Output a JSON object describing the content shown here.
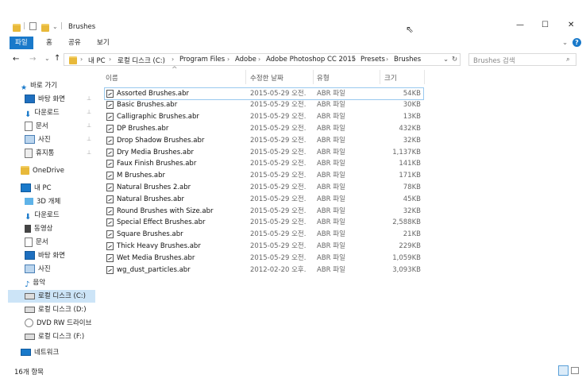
{
  "window": {
    "title": "Brushes",
    "controls": {
      "minimize": "—",
      "maximize": "☐",
      "close": "✕"
    }
  },
  "ribbon": {
    "tabs": [
      {
        "label": "파일",
        "active": true
      },
      {
        "label": "홈",
        "active": false
      },
      {
        "label": "공유",
        "active": false
      },
      {
        "label": "보기",
        "active": false
      }
    ],
    "expand": "⌄",
    "help": "?"
  },
  "address": {
    "back": "←",
    "forward": "→",
    "recent": "⌄",
    "up": "↑",
    "crumbs": [
      "내 PC",
      "로컬 디스크 (C:)",
      "Program Files",
      "Adobe",
      "Adobe Photoshop CC 2015",
      "Presets",
      "Brushes"
    ],
    "separator": "›",
    "dropdown": "⌄",
    "refresh": "↻",
    "search_placeholder": "Brushes 검색",
    "search_icon": "⌕"
  },
  "nav": {
    "quick_access": "바로 가기",
    "quick_items": [
      "바탕 화면",
      "다운로드",
      "문서",
      "사진",
      "휴지통"
    ],
    "onedrive": "OneDrive",
    "this_pc": "내 PC",
    "pc_items": [
      "3D 개체",
      "다운로드",
      "동영상",
      "문서",
      "바탕 화면",
      "사진",
      "음악",
      "로컬 디스크 (C:)",
      "로컬 디스크 (D:)",
      "DVD RW 드라이브",
      "로컬 디스크 (F:)"
    ],
    "network": "네트워크",
    "pin": "📌"
  },
  "columns": {
    "name": "이름",
    "date": "수정한 날짜",
    "type": "유형",
    "size": "크기",
    "sort_arrow": "^"
  },
  "files": [
    {
      "name": "Assorted Brushes.abr",
      "date": "2015-05-29 오전...",
      "type": "ABR 파일",
      "size": "54KB"
    },
    {
      "name": "Basic Brushes.abr",
      "date": "2015-05-29 오전...",
      "type": "ABR 파일",
      "size": "30KB"
    },
    {
      "name": "Calligraphic Brushes.abr",
      "date": "2015-05-29 오전...",
      "type": "ABR 파일",
      "size": "13KB"
    },
    {
      "name": "DP Brushes.abr",
      "date": "2015-05-29 오전...",
      "type": "ABR 파일",
      "size": "432KB"
    },
    {
      "name": "Drop Shadow Brushes.abr",
      "date": "2015-05-29 오전...",
      "type": "ABR 파일",
      "size": "32KB"
    },
    {
      "name": "Dry Media Brushes.abr",
      "date": "2015-05-29 오전...",
      "type": "ABR 파일",
      "size": "1,137KB"
    },
    {
      "name": "Faux Finish Brushes.abr",
      "date": "2015-05-29 오전...",
      "type": "ABR 파일",
      "size": "141KB"
    },
    {
      "name": "M Brushes.abr",
      "date": "2015-05-29 오전...",
      "type": "ABR 파일",
      "size": "171KB"
    },
    {
      "name": "Natural Brushes 2.abr",
      "date": "2015-05-29 오전...",
      "type": "ABR 파일",
      "size": "78KB"
    },
    {
      "name": "Natural Brushes.abr",
      "date": "2015-05-29 오전...",
      "type": "ABR 파일",
      "size": "45KB"
    },
    {
      "name": "Round Brushes with Size.abr",
      "date": "2015-05-29 오전...",
      "type": "ABR 파일",
      "size": "32KB"
    },
    {
      "name": "Special Effect Brushes.abr",
      "date": "2015-05-29 오전...",
      "type": "ABR 파일",
      "size": "2,588KB"
    },
    {
      "name": "Square Brushes.abr",
      "date": "2015-05-29 오전...",
      "type": "ABR 파일",
      "size": "21KB"
    },
    {
      "name": "Thick Heavy Brushes.abr",
      "date": "2015-05-29 오전...",
      "type": "ABR 파일",
      "size": "229KB"
    },
    {
      "name": "Wet Media Brushes.abr",
      "date": "2015-05-29 오전...",
      "type": "ABR 파일",
      "size": "1,059KB"
    },
    {
      "name": "wg_dust_particles.abr",
      "date": "2012-02-20 오후...",
      "type": "ABR 파일",
      "size": "3,093KB"
    }
  ],
  "status": {
    "count": "16개 항목"
  },
  "colors": {
    "accent": "#1979ca",
    "selection": "#cce4f7",
    "folder": "#e8b93a"
  }
}
